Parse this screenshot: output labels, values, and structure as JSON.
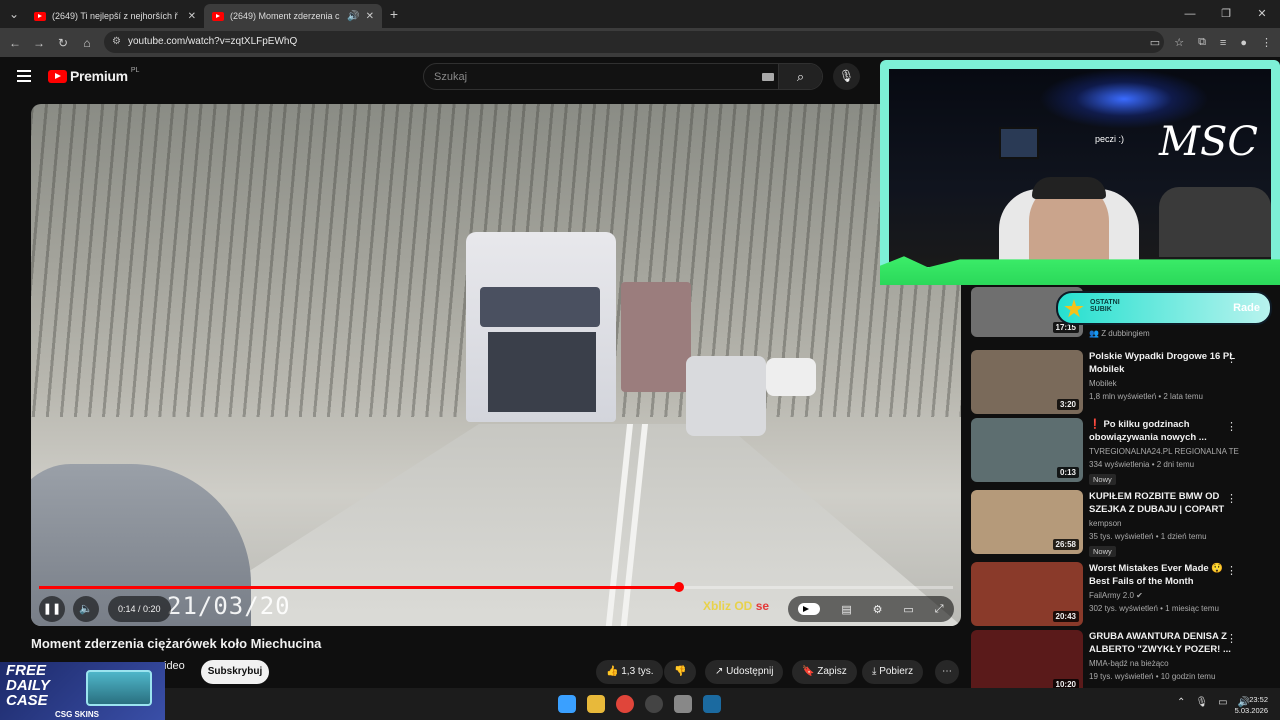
{
  "browser": {
    "tabs": [
      {
        "title": "(2649) Ti nejlepší z nejhorších ř"
      },
      {
        "title": "(2649) Moment zderzenia c"
      }
    ],
    "url": "youtube.com/watch?v=zqtXLFpEWhQ"
  },
  "youtube": {
    "logo": "Premium",
    "region": "PL",
    "search_placeholder": "Szukaj"
  },
  "player": {
    "time": "0:14 / 0:20",
    "progress": 0.7,
    "overlay_date": "21/03/20",
    "watermark_a": "Xbliz OD",
    "watermark_b": "se"
  },
  "video": {
    "title": "Moment zderzenia ciężarówek koło Miechucina",
    "channel_fragment": "ideo",
    "subscribe": "Subskrybuj",
    "likes": "1,3 tys.",
    "share": "Udostępnij",
    "save": "Zapisz",
    "download": "Pobierz"
  },
  "overlay": {
    "cam_text": "peczi :)",
    "cam_logo": "MSC",
    "badge_line1": "OSTATNI",
    "badge_line2": "SUBIK",
    "badge_name": "Rade",
    "promo_free": "FREE",
    "promo_daily": "DAILY",
    "promo_case": "CASE",
    "promo_brand": "CSG SKINS"
  },
  "sidebar": {
    "first_tag": "Z dubbingiem",
    "first_duration": "17:15",
    "videos": [
      {
        "title": "Polskie Wypadki Drogowe  16 PL Mobilek",
        "channel": "Mobilek",
        "meta": "1,8 mln wyświetleń • 2 lata temu",
        "duration": "3:20",
        "badge": "",
        "thumb": "#7a6a5a"
      },
      {
        "title": "❗ Po kilku godzinach obowiązywania nowych ...",
        "channel": "TVREGIONALNA24.PL REGIONALNA TE...",
        "meta": "334 wyświetlenia • 2 dni temu",
        "duration": "0:13",
        "badge": "Nowy",
        "thumb": "#5d6e70"
      },
      {
        "title": "KUPIŁEM ROZBITE BMW OD SZEJKA Z DUBAJU | COPART",
        "channel": "kempson",
        "meta": "35 tys. wyświetleń • 1 dzień temu",
        "duration": "26:58",
        "badge": "Nowy",
        "thumb": "#b59a7a"
      },
      {
        "title": "Worst Mistakes Ever Made 😲 Best Fails of the Month",
        "channel": "FailArmy 2.0 ✔",
        "meta": "302 tys. wyświetleń • 1 miesiąc temu",
        "duration": "20:43",
        "badge": "",
        "thumb": "#8a3a2a"
      },
      {
        "title": "GRUBA AWANTURA DENISA Z ALBERTO \"ZWYKŁY POZER! ...",
        "channel": "MMA-bądź na bieżąco",
        "meta": "19 tys. wyświetleń • 10 godzin temu",
        "duration": "10:20",
        "badge": "",
        "thumb": "#5a1a1a"
      }
    ]
  },
  "taskbar": {
    "time": "23:52",
    "date": "5.03.2026"
  }
}
